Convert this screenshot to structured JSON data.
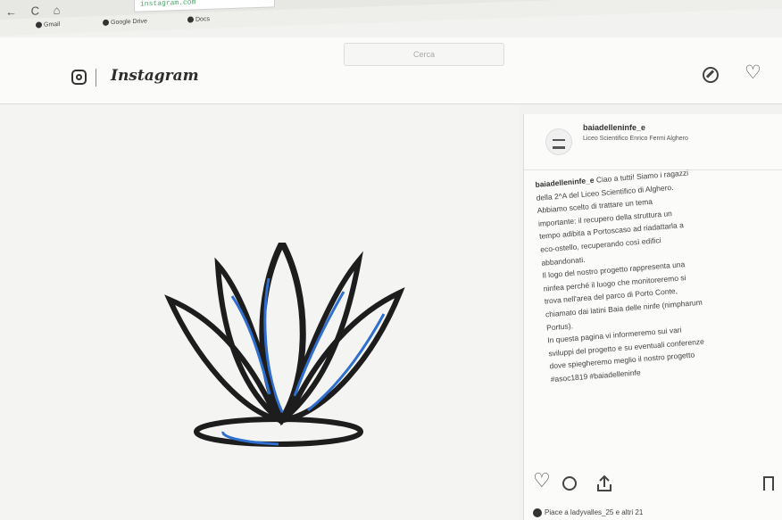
{
  "browser": {
    "nav": "← C ⌂",
    "url": "instagram.com",
    "bookmarks": [
      "Gmail",
      "Google Drive",
      "Docs"
    ]
  },
  "instagram": {
    "wordmark": "Instagram",
    "search_placeholder": "Cerca"
  },
  "post": {
    "username": "baiadelleninfe_e",
    "location": "Liceo Scientifico Enrico Fermi Alghero",
    "caption_user": "baiadelleninfe_e",
    "caption_lines": [
      "Ciao a tutti! Siamo i ragazzi",
      "della 2^A del Liceo Scientifico di Alghero.",
      "Abbiamo scelto di trattare un tema",
      "importante: il recupero della struttura un",
      "tempo adibita a Portoscaso ad riadattarla a",
      "eco-ostello, recuperando così edifici",
      "abbandonati.",
      "Il logo del nostro progetto rappresenta una",
      "ninfea perché il luogo che monitoreremo si",
      "trova nell'area del parco di Porto Conte,",
      "chiamato dai latini Baia delle ninfe (nimpharum",
      "Portus).",
      "In questa pagina vi informeremo sui vari",
      "sviluppi del progetto e su eventuali conferenze",
      "dove spiegheremo meglio il nostro progetto",
      "#asoc1819 #baiadelleninfe"
    ],
    "likes_text": "Piace a ladyvalles_25 e altri 21"
  },
  "colors": {
    "lotus_outline": "#1d1d1d",
    "lotus_blue": "#2f6fd0",
    "page_bg": "#f2f2f0"
  }
}
